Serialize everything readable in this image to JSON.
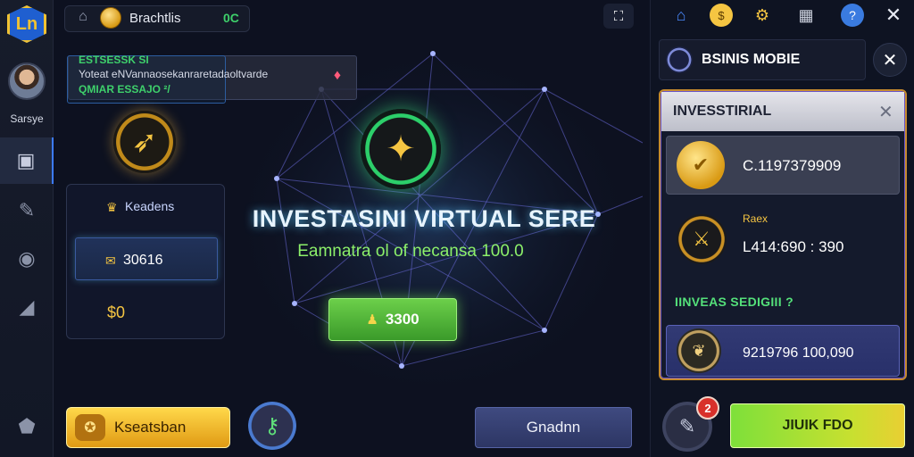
{
  "topbar": {
    "title": "Brachtlis",
    "count": "0C",
    "home_icon": "home-icon",
    "coin_icon": "coin-icon",
    "expand_icon": "expand-icon"
  },
  "sidebar": {
    "logo_text": "Ln",
    "avatar_name": "Sarsye",
    "items": [
      {
        "icon": "wallet-icon",
        "glyph": "▣"
      },
      {
        "icon": "pen-icon",
        "glyph": "✎"
      },
      {
        "icon": "circle-icon",
        "glyph": "◉"
      },
      {
        "icon": "chart-icon",
        "glyph": "◢"
      },
      {
        "icon": "shield-icon",
        "glyph": "⬟"
      }
    ]
  },
  "tooltip": {
    "line1": "ESTSESSK SI",
    "line2": "Yoteat eNVannaosekanraretadaoltvarde",
    "line3": "QMIAR ESSAJO   ²/"
  },
  "stats_panel": {
    "title": "Keadens",
    "value": "30616",
    "zero": "$0"
  },
  "hero": {
    "title": "INVESTASINI VIRTUAL SERE",
    "subtitle": "Eamnatra ol of necansa 100.0",
    "button_label": "3300"
  },
  "bottom": {
    "left_button": "Kseatsban",
    "center_button": "Gnadnn"
  },
  "right": {
    "mobile_title": "BSINIS MOBIE",
    "invest_title": "INVESSTIRIAL",
    "row1_value": "C.1197379909",
    "row2_label": "Raex",
    "row2_value": "L414:690 : 390",
    "section_label": "IINVEAS SEDIGIII ?",
    "row3_value": "9219796 100,090",
    "badge_count": "2",
    "join_button": "JIUIK FDO"
  },
  "colors": {
    "accent_green": "#3ed06b",
    "gold": "#f5c542",
    "panel_border": "#c58a2e",
    "blue": "#3a7be0"
  }
}
